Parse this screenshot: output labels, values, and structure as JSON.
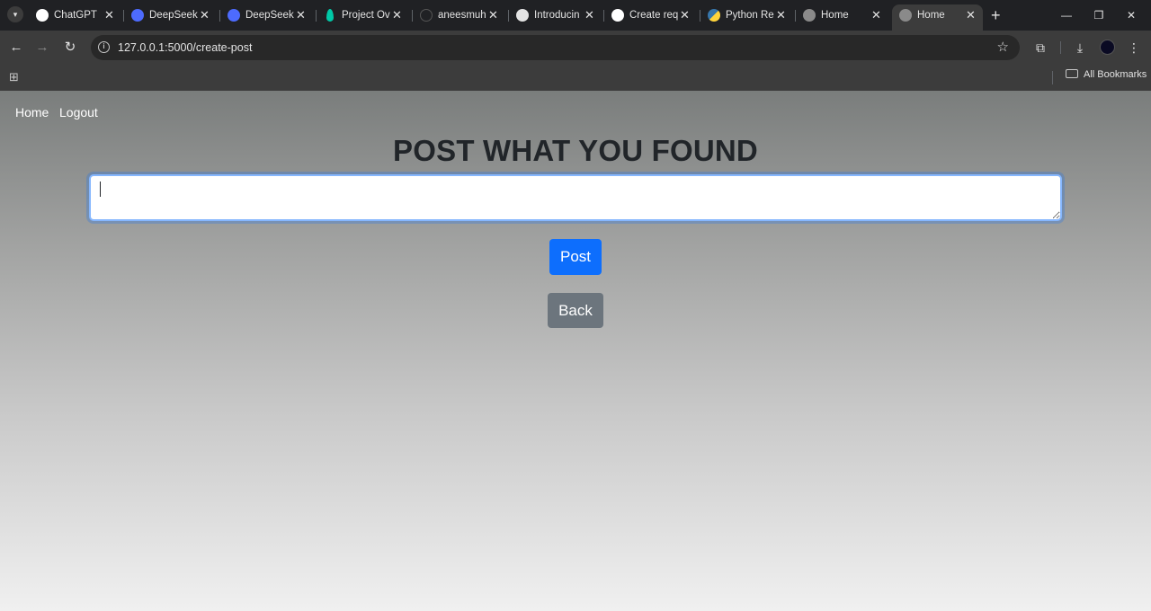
{
  "browser": {
    "tabs": [
      {
        "label": "ChatGPT",
        "icon": "openai-icon",
        "active": false
      },
      {
        "label": "DeepSeek",
        "icon": "deepseek-icon",
        "active": false
      },
      {
        "label": "DeepSeek",
        "icon": "deepseek-icon",
        "active": false
      },
      {
        "label": "Project Ov",
        "icon": "leaf-icon",
        "active": false
      },
      {
        "label": "aneesmuh",
        "icon": "github-icon",
        "active": false
      },
      {
        "label": "Introducin",
        "icon": "openai-icon",
        "active": false
      },
      {
        "label": "Create req",
        "icon": "openai-icon",
        "active": false
      },
      {
        "label": "Python Re",
        "icon": "python-icon",
        "active": false
      },
      {
        "label": "Home",
        "icon": "globe-icon",
        "active": false
      },
      {
        "label": "Home",
        "icon": "globe-icon",
        "active": true
      }
    ],
    "url": "127.0.0.1:5000/create-post",
    "bookmarks_all_label": "All Bookmarks"
  },
  "nav": {
    "home_label": "Home",
    "logout_label": "Logout"
  },
  "main": {
    "title": "POST WHAT YOU FOUND",
    "input_value": "",
    "post_label": "Post",
    "back_label": "Back"
  },
  "colors": {
    "primary": "#0d6efd",
    "secondary": "#6c757d",
    "title": "#212529",
    "browser_chrome": "#3c3c3c"
  }
}
